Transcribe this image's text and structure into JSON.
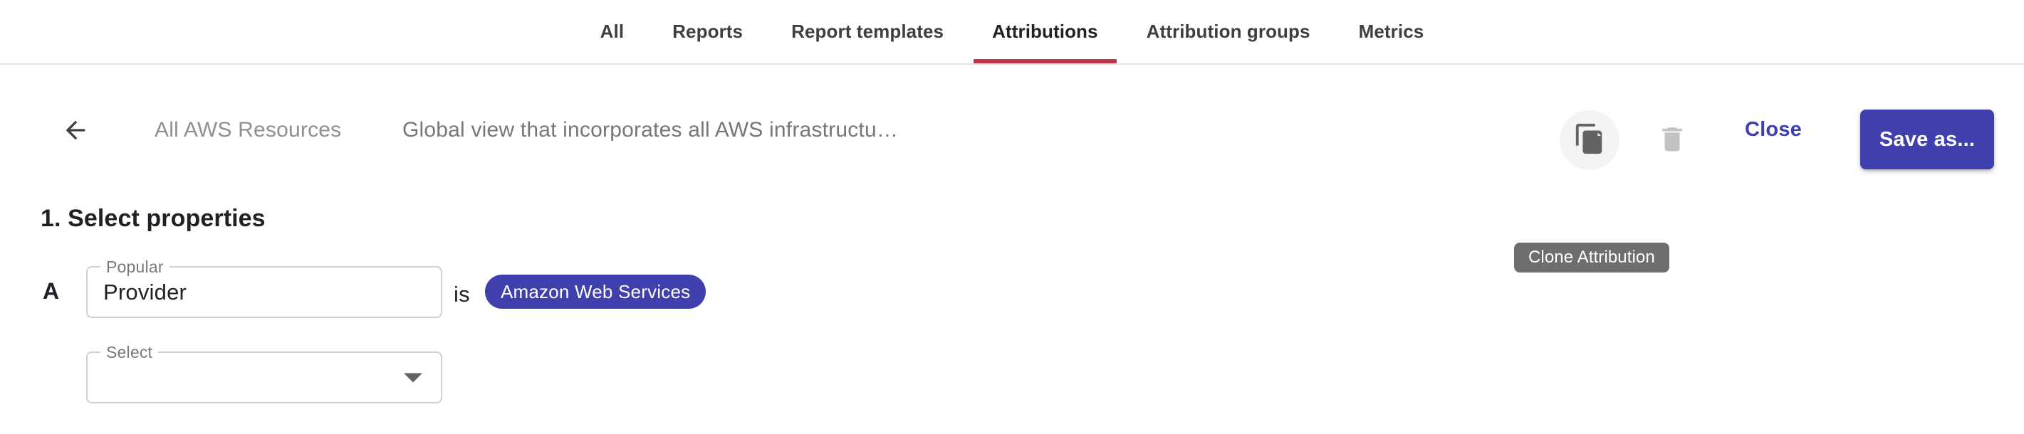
{
  "tabs": [
    {
      "label": "All",
      "active": false
    },
    {
      "label": "Reports",
      "active": false
    },
    {
      "label": "Report templates",
      "active": false
    },
    {
      "label": "Attributions",
      "active": true
    },
    {
      "label": "Attribution groups",
      "active": false
    },
    {
      "label": "Metrics",
      "active": false
    }
  ],
  "header": {
    "back_icon": "arrow-left-icon",
    "attribution_name": "All AWS Resources",
    "attribution_description": "Global view that incorporates all AWS infrastructu…",
    "clone_icon": "copy-icon",
    "delete_icon": "trash-icon",
    "close_label": "Close",
    "save_as_label": "Save as...",
    "tooltip": "Clone Attribution"
  },
  "section": {
    "title": "1. Select properties",
    "row_letter": "A",
    "property_field": {
      "legend": "Popular",
      "value": "Provider"
    },
    "operator": "is",
    "chip_value": "Amazon Web Services",
    "select_field": {
      "legend": "Select",
      "value": "",
      "chevron_icon": "chevron-down-icon"
    }
  },
  "colors": {
    "accent_indigo": "#3f3fae",
    "active_tab_indicator": "#c4314b",
    "tooltip_bg": "#6e6e6e",
    "muted_text": "#8e9094",
    "field_border": "#cfd0d2",
    "disabled_icon": "#c0c0c0"
  }
}
